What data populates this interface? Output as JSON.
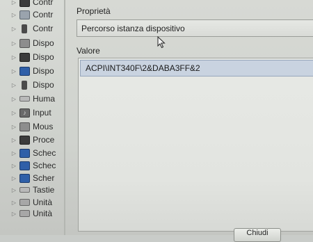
{
  "device_tree": {
    "items": [
      {
        "label": "Contr",
        "icon": "chip-icon"
      },
      {
        "label": "Contr",
        "icon": "usb-controller-icon"
      },
      {
        "label": "Contr",
        "icon": "plug-icon"
      },
      {
        "label": "Dispo",
        "icon": "disk-icon"
      },
      {
        "label": "Dispo",
        "icon": "device-icon"
      },
      {
        "label": "Dispo",
        "icon": "monitor-icon"
      },
      {
        "label": "Dispo",
        "icon": "phone-device-icon"
      },
      {
        "label": "Huma",
        "icon": "human-interface-icon"
      },
      {
        "label": "Input",
        "icon": "audio-input-icon"
      },
      {
        "label": "Mous",
        "icon": "mouse-icon"
      },
      {
        "label": "Proce",
        "icon": "processor-icon"
      },
      {
        "label": "Schec",
        "icon": "network-card-icon"
      },
      {
        "label": "Schec",
        "icon": "audio-card-icon"
      },
      {
        "label": "Scher",
        "icon": "display-adapter-icon"
      },
      {
        "label": "Tastie",
        "icon": "keyboard-icon"
      },
      {
        "label": "Unità",
        "icon": "drive-icon"
      },
      {
        "label": "Unità",
        "icon": "disk-drive-icon"
      }
    ]
  },
  "dialog": {
    "property_label": "Proprietà",
    "property_selected": "Percorso istanza dispositivo",
    "value_label": "Valore",
    "value_text": "ACPI\\INT340F\\2&DABA3FF&2",
    "ok_label": "Chiudi"
  }
}
